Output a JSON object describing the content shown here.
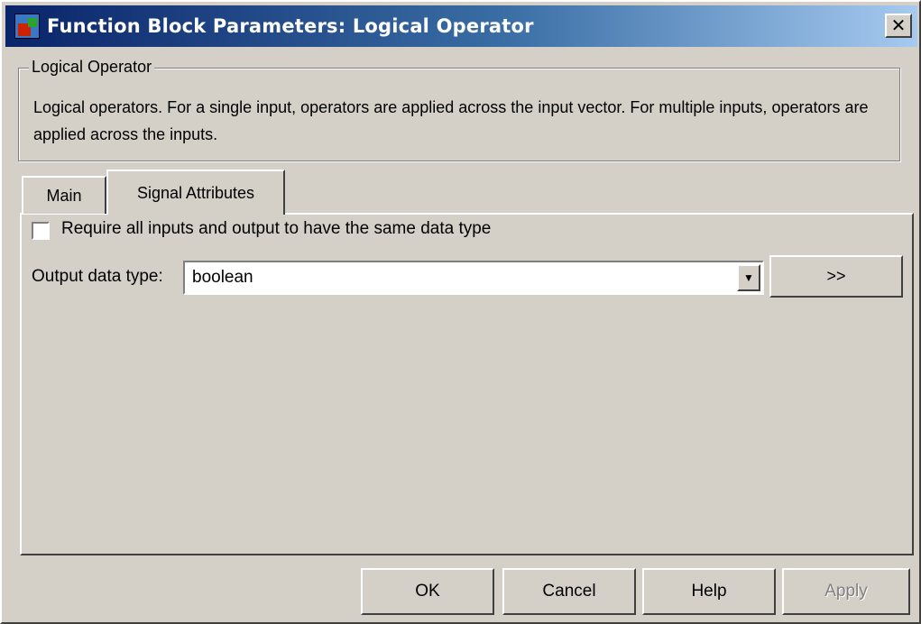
{
  "window": {
    "title": "Function Block Parameters: Logical Operator"
  },
  "group": {
    "legend": "Logical Operator",
    "description": "Logical operators.  For a single input, operators are applied across the input vector.  For multiple inputs, operators are applied across the inputs."
  },
  "tabs": [
    {
      "label": "Main",
      "active": false
    },
    {
      "label": "Signal Attributes",
      "active": true
    }
  ],
  "signal_attributes": {
    "checkbox_label": "Require all inputs and output to have the same data type",
    "checkbox_checked": false,
    "output_type_label": "Output data type:",
    "output_type_value": "boolean",
    "expand_label": ">>"
  },
  "buttons": {
    "ok": "OK",
    "cancel": "Cancel",
    "help": "Help",
    "apply": "Apply"
  },
  "icons": {
    "app": "simulink-block-icon",
    "close": "close-icon",
    "dropdown": "chevron-down-icon"
  },
  "colors": {
    "face": "#d4d0c8",
    "title_start": "#0a246a",
    "title_end": "#a6caf0"
  }
}
